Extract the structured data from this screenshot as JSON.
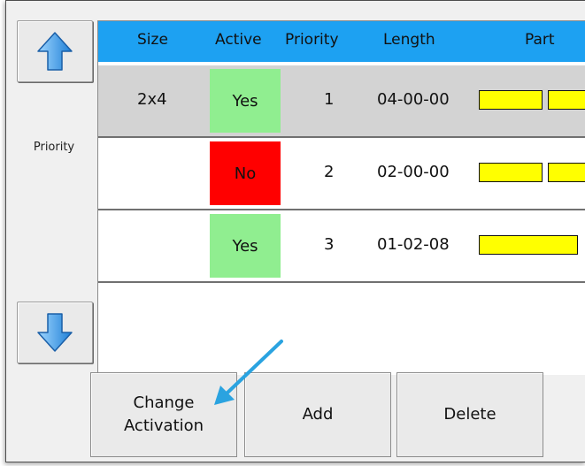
{
  "side": {
    "up_icon": "up-arrow-icon",
    "down_icon": "down-arrow-icon",
    "label": "Priority"
  },
  "table": {
    "columns": [
      "Size",
      "Active",
      "Priority",
      "Length",
      "Part"
    ],
    "rows": [
      {
        "size": "2x4",
        "active": "Yes",
        "priority": "1",
        "length": "04-00-00",
        "selected": true
      },
      {
        "size": "",
        "active": "No",
        "priority": "2",
        "length": "02-00-00",
        "selected": false
      },
      {
        "size": "",
        "active": "Yes",
        "priority": "3",
        "length": "01-02-08",
        "selected": false
      }
    ]
  },
  "buttons": {
    "change_activation": "Change\nActivation",
    "add": "Add",
    "delete": "Delete"
  },
  "colors": {
    "header": "#1da1f2",
    "active_yes": "#90ee90",
    "active_no": "#ff0000",
    "part_fill": "#ffff00",
    "annotation_arrow": "#2aa3e0"
  }
}
